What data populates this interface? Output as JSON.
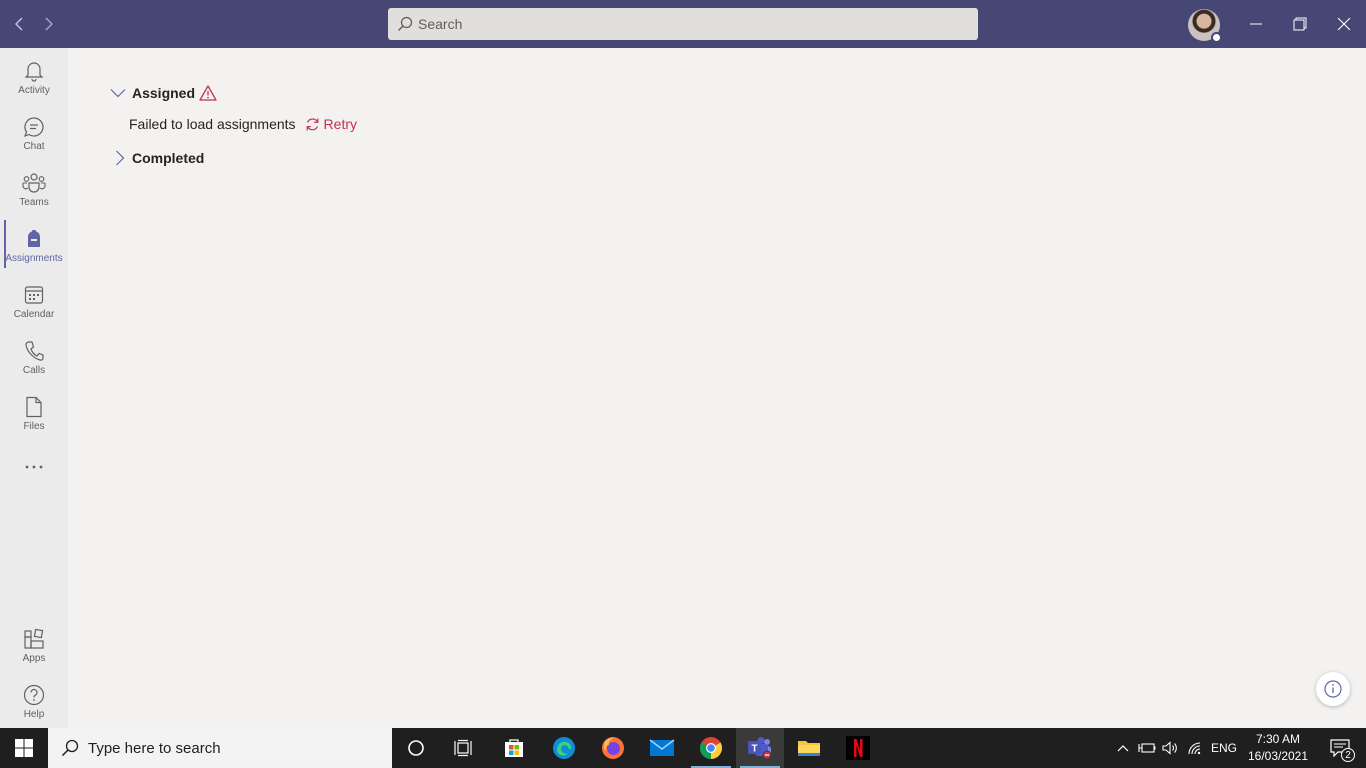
{
  "titlebar": {
    "search_placeholder": "Search"
  },
  "rail": {
    "items": [
      {
        "label": "Activity",
        "icon": "bell-icon"
      },
      {
        "label": "Chat",
        "icon": "chat-icon"
      },
      {
        "label": "Teams",
        "icon": "teams-icon"
      },
      {
        "label": "Assignments",
        "icon": "assignments-icon",
        "active": true
      },
      {
        "label": "Calendar",
        "icon": "calendar-icon"
      },
      {
        "label": "Calls",
        "icon": "phone-icon"
      },
      {
        "label": "Files",
        "icon": "file-icon"
      }
    ],
    "bottom": [
      {
        "label": "Apps",
        "icon": "apps-icon"
      },
      {
        "label": "Help",
        "icon": "help-icon"
      }
    ]
  },
  "main": {
    "assigned_title": "Assigned",
    "error_text": "Failed to load assignments",
    "retry_label": "Retry",
    "completed_title": "Completed"
  },
  "taskbar": {
    "search_text": "Type here to search",
    "language": "ENG",
    "time": "7:30 AM",
    "date": "16/03/2021",
    "notification_count": "2"
  },
  "colors": {
    "titlebar": "#464775",
    "accent": "#6264a7",
    "error": "#c4314b",
    "background": "#f3f2f1",
    "rail": "#ebebeb",
    "taskbar": "#1f1f1f"
  }
}
